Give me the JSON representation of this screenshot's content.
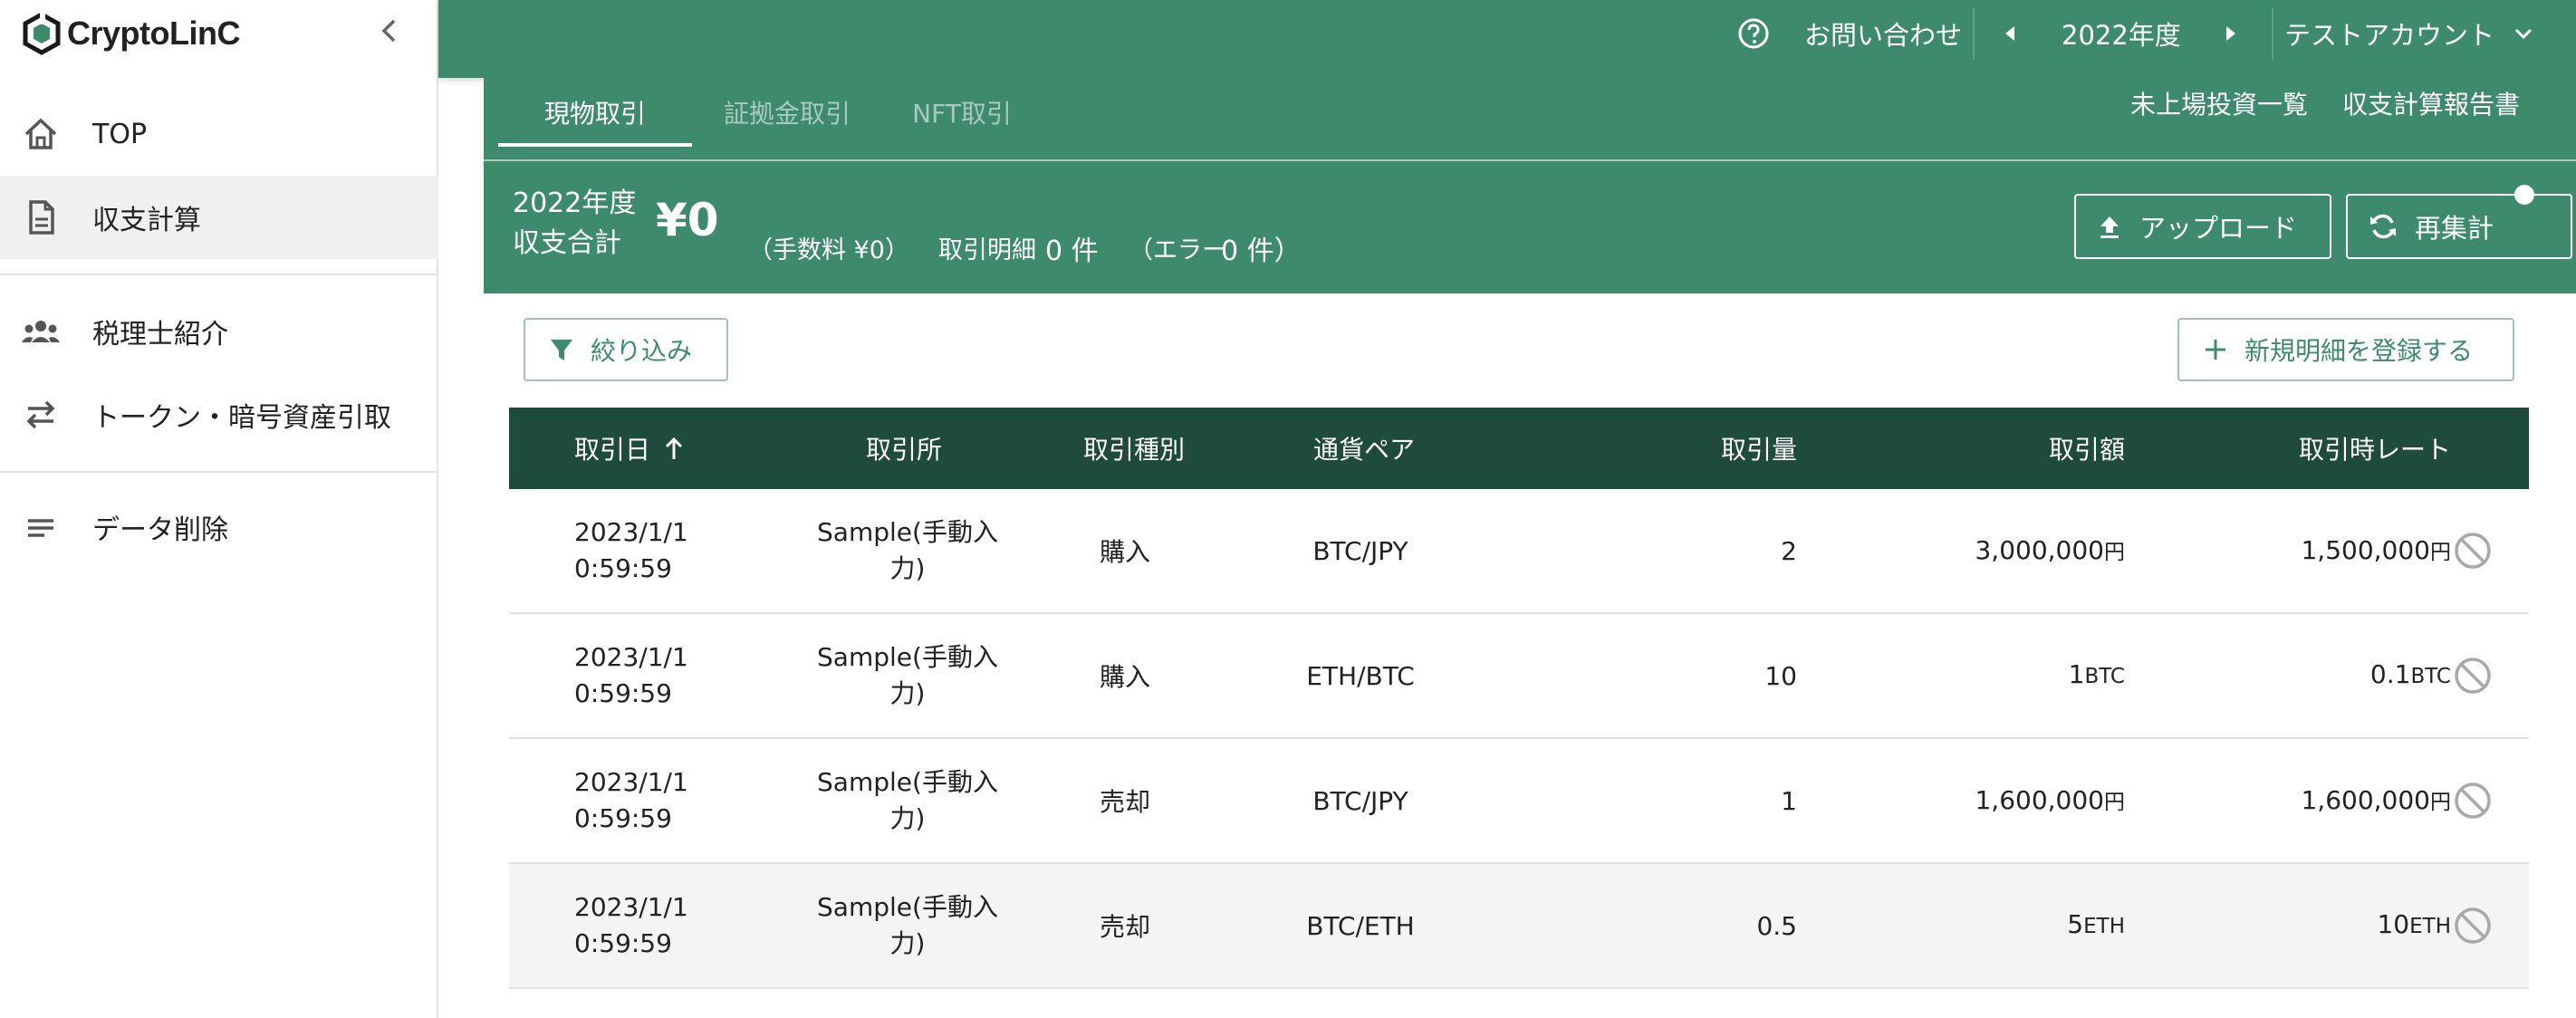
{
  "app": {
    "logo_text": "CryptoLinC"
  },
  "sidebar": {
    "items": [
      {
        "label": "TOP",
        "icon": "home-icon"
      },
      {
        "label": "収支計算",
        "icon": "document-icon"
      },
      {
        "label": "税理士紹介",
        "icon": "people-icon"
      },
      {
        "label": "トークン・暗号資産引取",
        "icon": "swap-icon"
      },
      {
        "label": "データ削除",
        "icon": "lines-icon"
      }
    ]
  },
  "topbar": {
    "contact": "お問い合わせ",
    "year": "2022年度",
    "account": "テストアカウント"
  },
  "tabs": [
    "現物取引",
    "証拠金取引",
    "NFT取引"
  ],
  "head_links": {
    "unlisted": "未上場投資一覧",
    "report": "収支計算報告書"
  },
  "summary": {
    "year_label": "2022年度",
    "total_label": "収支合計",
    "amount": "¥0",
    "fee": "（手数料 ¥0）",
    "detail_label": "取引明細",
    "detail_count": "0 件",
    "error_label": "（エラー",
    "error_count": "0 件）"
  },
  "buttons": {
    "upload": "アップロード",
    "recalc": "再集計",
    "filter": "絞り込み",
    "new_entry": "新規明細を登録する"
  },
  "table": {
    "headers": [
      "取引日",
      "取引所",
      "取引種別",
      "通貨ペア",
      "取引量",
      "取引額",
      "取引時レート"
    ],
    "rows": [
      {
        "date": "2023/1/1",
        "time": "0:59:59",
        "exchange_1": "Sample(手動入",
        "exchange_2": "力)",
        "type": "購入",
        "pair": "BTC/JPY",
        "qty": "2",
        "amount": "3,000,000",
        "amount_unit": "円",
        "rate": "1,500,000",
        "rate_unit": "円"
      },
      {
        "date": "2023/1/1",
        "time": "0:59:59",
        "exchange_1": "Sample(手動入",
        "exchange_2": "力)",
        "type": "購入",
        "pair": "ETH/BTC",
        "qty": "10",
        "amount": "1",
        "amount_unit": "BTC",
        "rate": "0.1",
        "rate_unit": "BTC"
      },
      {
        "date": "2023/1/1",
        "time": "0:59:59",
        "exchange_1": "Sample(手動入",
        "exchange_2": "力)",
        "type": "売却",
        "pair": "BTC/JPY",
        "qty": "1",
        "amount": "1,600,000",
        "amount_unit": "円",
        "rate": "1,600,000",
        "rate_unit": "円"
      },
      {
        "date": "2023/1/1",
        "time": "0:59:59",
        "exchange_1": "Sample(手動入",
        "exchange_2": "力)",
        "type": "売却",
        "pair": "BTC/ETH",
        "qty": "0.5",
        "amount": "5",
        "amount_unit": "ETH",
        "rate": "10",
        "rate_unit": "ETH"
      }
    ]
  },
  "colors": {
    "primary": "#3e8a6d",
    "table_header": "#1f4b3c"
  }
}
